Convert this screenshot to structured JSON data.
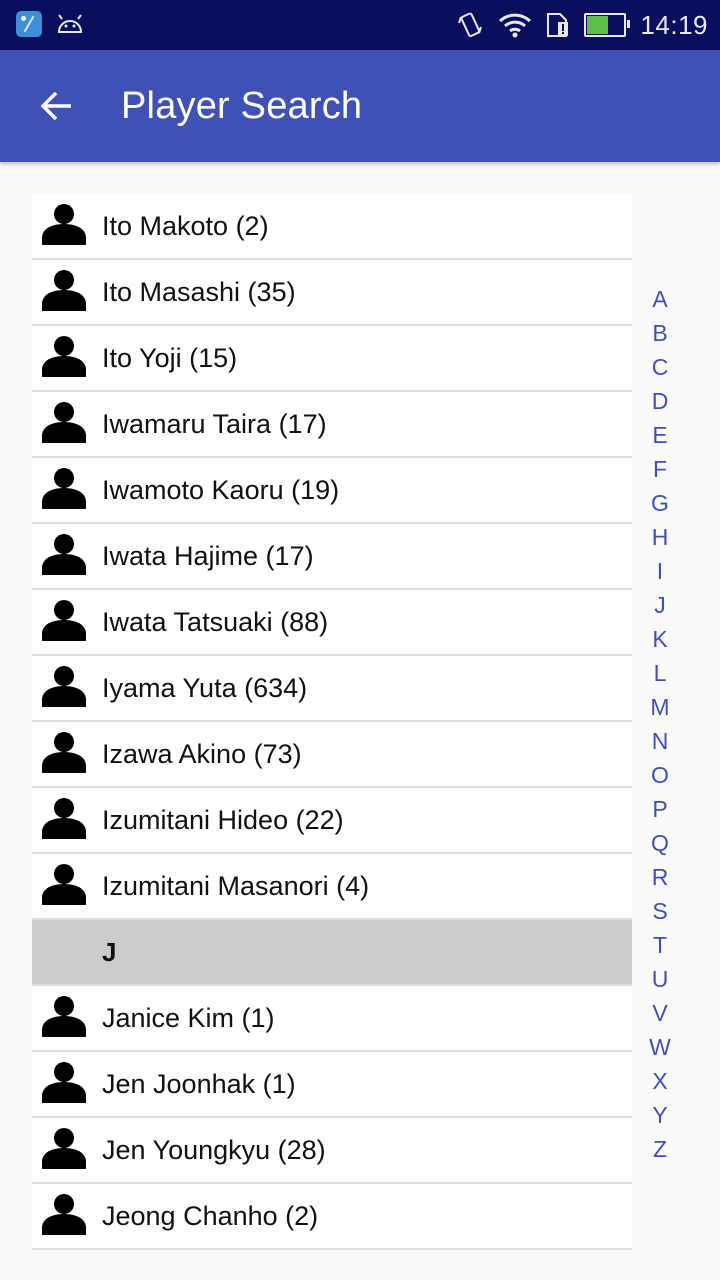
{
  "status_bar": {
    "time": "14:19",
    "icons": [
      "app-badge-icon",
      "android-icon",
      "vibrate-icon",
      "wifi-icon",
      "sim-alert-icon",
      "battery-charging-icon"
    ],
    "battery_level": 0.55
  },
  "app_bar": {
    "back_icon": "arrow-left-icon",
    "title": "Player Search"
  },
  "list": {
    "groups": [
      {
        "header": null,
        "items": [
          {
            "name": "Ito Makoto (2)"
          },
          {
            "name": "Ito Masashi (35)"
          },
          {
            "name": "Ito Yoji (15)"
          },
          {
            "name": "Iwamaru Taira (17)"
          },
          {
            "name": "Iwamoto Kaoru (19)"
          },
          {
            "name": "Iwata Hajime (17)"
          },
          {
            "name": "Iwata Tatsuaki (88)"
          },
          {
            "name": "Iyama Yuta (634)"
          },
          {
            "name": "Izawa Akino (73)"
          },
          {
            "name": "Izumitani Hideo (22)"
          },
          {
            "name": "Izumitani Masanori (4)"
          }
        ]
      },
      {
        "header": "J",
        "items": [
          {
            "name": "Janice Kim (1)"
          },
          {
            "name": "Jen Joonhak (1)"
          },
          {
            "name": "Jen Youngkyu (28)"
          },
          {
            "name": "Jeong Chanho (2)"
          }
        ]
      }
    ]
  },
  "alphabet_index": [
    "A",
    "B",
    "C",
    "D",
    "E",
    "F",
    "G",
    "H",
    "I",
    "J",
    "K",
    "L",
    "M",
    "N",
    "O",
    "P",
    "Q",
    "R",
    "S",
    "T",
    "U",
    "V",
    "W",
    "X",
    "Y",
    "Z"
  ],
  "colors": {
    "status_bar": "#0b0e5c",
    "app_bar": "#3f51b5",
    "index_text": "#3f51b5",
    "section_header": "#cccccc"
  }
}
